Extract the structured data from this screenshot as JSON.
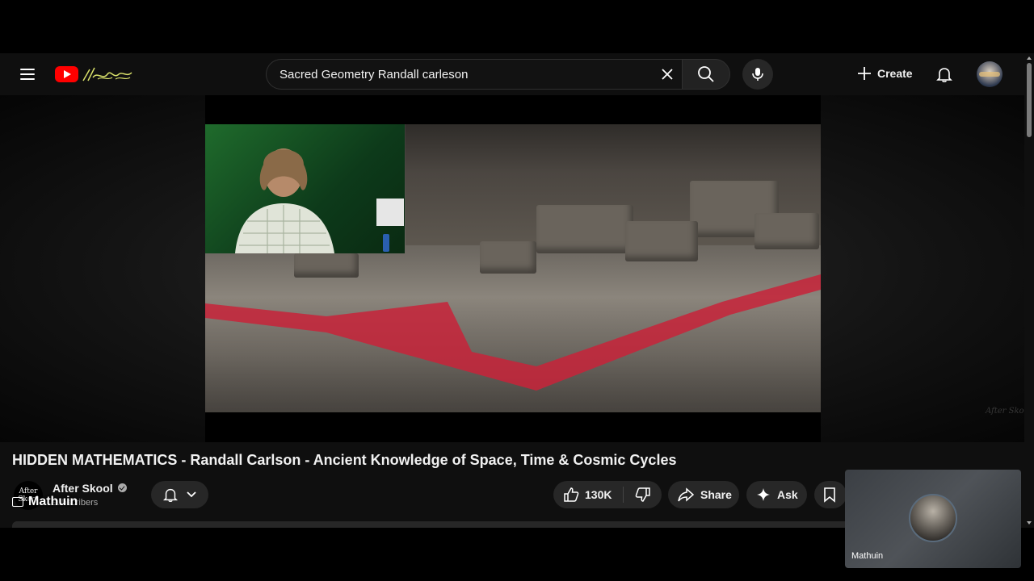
{
  "masthead": {
    "search_value": "Sacred Geometry Randall carleson",
    "search_placeholder": "Search",
    "create_label": "Create",
    "icons": [
      "menu-icon",
      "youtube-logo-icon",
      "close-icon",
      "search-icon",
      "mic-icon",
      "plus-icon",
      "bell-icon"
    ]
  },
  "video": {
    "title": "HIDDEN MATHEMATICS - Randall Carlson - Ancient Knowledge of Space, Time & Cosmic Cycles",
    "channel_name": "After Skool",
    "subscribers": "subscribers",
    "channel_avatar_text": "After Skool",
    "overlay_participant": "Mathuin",
    "watermark": "After Skool"
  },
  "actions": {
    "like_count": "130K",
    "share_label": "Share",
    "ask_label": "Ask"
  },
  "pip": {
    "name": "Mathuin"
  },
  "colors": {
    "background": "#0f0f0f",
    "pill": "#272727",
    "brand_red": "#ff0000",
    "text": "#f1f1f1",
    "secondary_text": "#aaaaaa"
  }
}
